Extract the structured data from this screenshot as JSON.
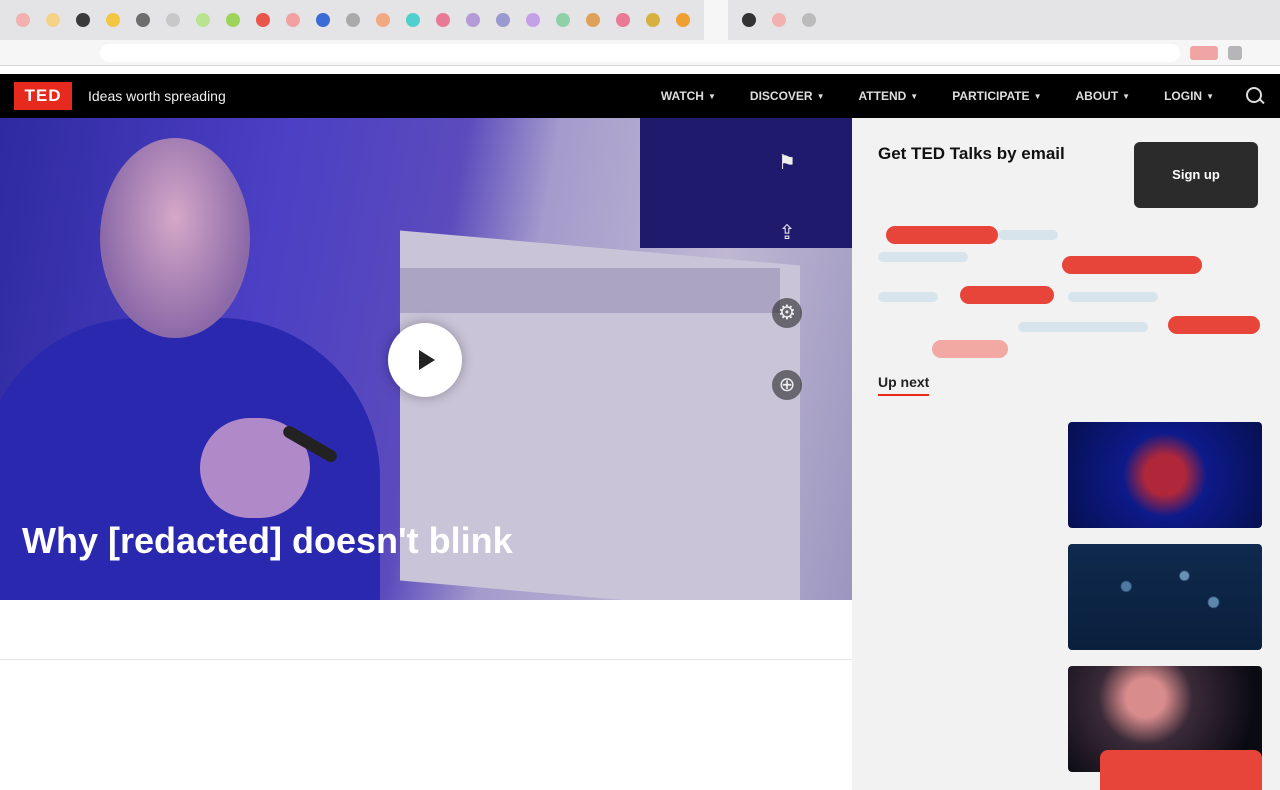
{
  "browser": {
    "tab_colors": [
      "#f2b0b0",
      "#f5d28a",
      "#3a3a3a",
      "#f3c641",
      "#6e6e6e",
      "#c8c8c8",
      "#b8e38f",
      "#9dd45a",
      "#e8554b",
      "#f2a1a1",
      "#3b6cd6",
      "#aaaaaa",
      "#f2a880",
      "#4fd0cf",
      "#e87a96",
      "#b59ad8",
      "#9a9ad0",
      "#c3a0e8",
      "#8fd0a8",
      "#e0a05a",
      "#e87a96",
      "#d8b040",
      "#f0a030",
      "#333333",
      "#f2b0b0",
      "#bbbbbb"
    ],
    "url": ""
  },
  "header": {
    "logo": "TED",
    "tagline": "Ideas worth spreading",
    "nav": [
      {
        "label": "WATCH",
        "icon": "caret-down-icon"
      },
      {
        "label": "DISCOVER",
        "icon": "caret-down-icon"
      },
      {
        "label": "ATTEND",
        "icon": "caret-down-icon"
      },
      {
        "label": "PARTICIPATE",
        "icon": "caret-down-icon"
      },
      {
        "label": "ABOUT",
        "icon": "caret-down-icon"
      },
      {
        "label": "LOGIN",
        "icon": "caret-down-icon"
      }
    ]
  },
  "video": {
    "meta": "",
    "title": "Why [redacted] doesn't blink",
    "controls": [
      "bookmark-icon",
      "share-icon",
      "settings-icon",
      "language-icon"
    ]
  },
  "stats": [
    {
      "value": "",
      "label": "",
      "active": true
    },
    {
      "value": "",
      "label": "",
      "active": false
    }
  ],
  "description": "",
  "about": {
    "heading": "",
    "sub": "",
    "line": ""
  },
  "sidebar": {
    "email_title": "Get TED Talks by email",
    "email_text": "",
    "signup_label": "Sign up",
    "topics": [
      {
        "label": "",
        "style": "strong"
      },
      {
        "label": "",
        "style": "strong"
      },
      {
        "label": "",
        "style": "strong"
      },
      {
        "label": "",
        "style": "strong"
      },
      {
        "label": "",
        "style": "light"
      }
    ],
    "up_next_label": "Up next",
    "recommendations": [
      {
        "title": "",
        "speaker": ""
      },
      {
        "title": "",
        "speaker": ""
      },
      {
        "title": "",
        "speaker": ""
      }
    ]
  },
  "floating_button": ""
}
